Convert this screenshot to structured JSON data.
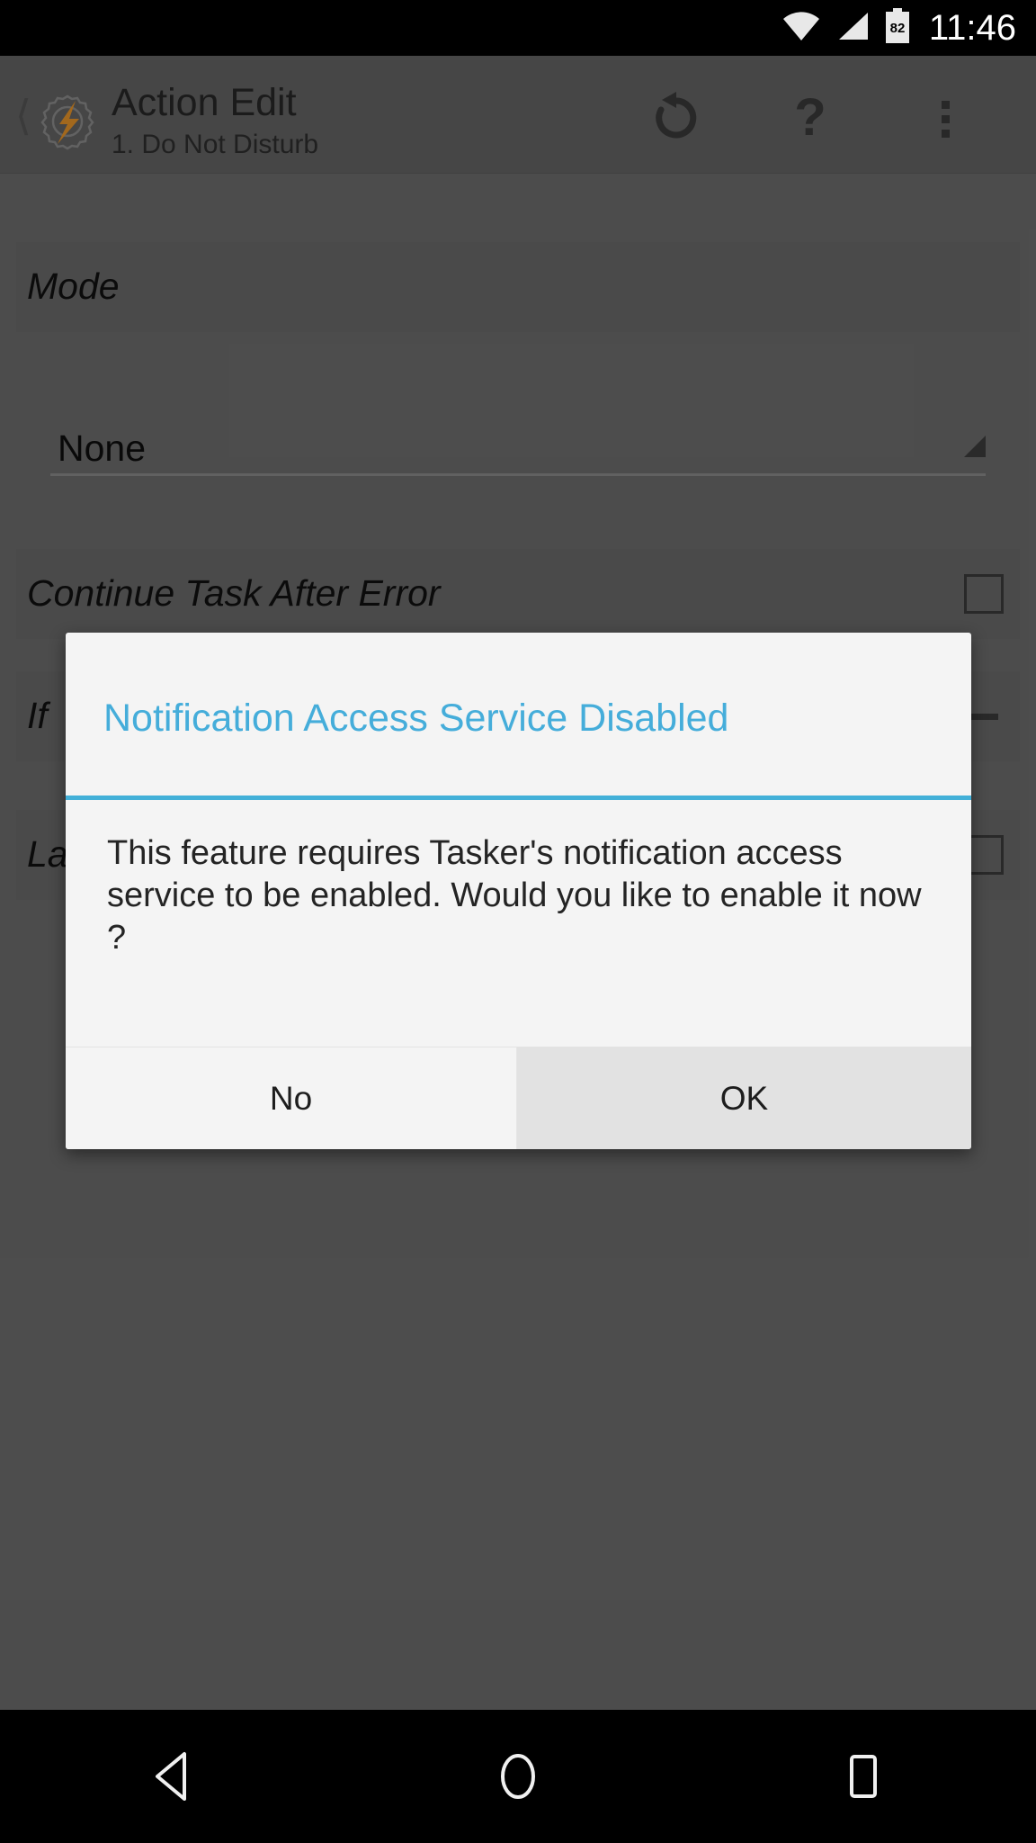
{
  "status_bar": {
    "time": "11:46",
    "battery_level": "82",
    "icons": [
      "wifi-icon",
      "cellular-signal-icon",
      "battery-icon"
    ]
  },
  "action_bar": {
    "back_icon": "back-chevron-icon",
    "logo_icon": "tasker-gear-lightning-icon",
    "title": "Action Edit",
    "subtitle": "1. Do Not Disturb",
    "actions": [
      {
        "name": "undo-icon",
        "label": "Undo"
      },
      {
        "name": "help-icon",
        "label": "?"
      },
      {
        "name": "overflow-menu-icon",
        "label": "More options"
      }
    ]
  },
  "form": {
    "rows": [
      {
        "label": "Mode",
        "control": "spinner"
      },
      {
        "label": "Continue Task After Error",
        "control": "checkbox",
        "checked": false
      },
      {
        "label": "If",
        "control": "dash"
      },
      {
        "label": "Label",
        "control": "checkbox",
        "checked": false
      }
    ],
    "spinner": {
      "value": "None",
      "caret_icon": "dropdown-caret-icon"
    }
  },
  "dialog": {
    "title": "Notification Access Service Disabled",
    "message": "This feature requires Tasker's notification access service to be enabled. Would you like to enable it now ?",
    "buttons": {
      "negative": "No",
      "positive": "OK"
    },
    "accent_color": "#43b0d8",
    "title_color": "#45adda",
    "background_color": "#f4f4f4"
  },
  "nav_bar": {
    "back": "back-triangle-icon",
    "home": "home-circle-icon",
    "recents": "recents-square-icon"
  }
}
